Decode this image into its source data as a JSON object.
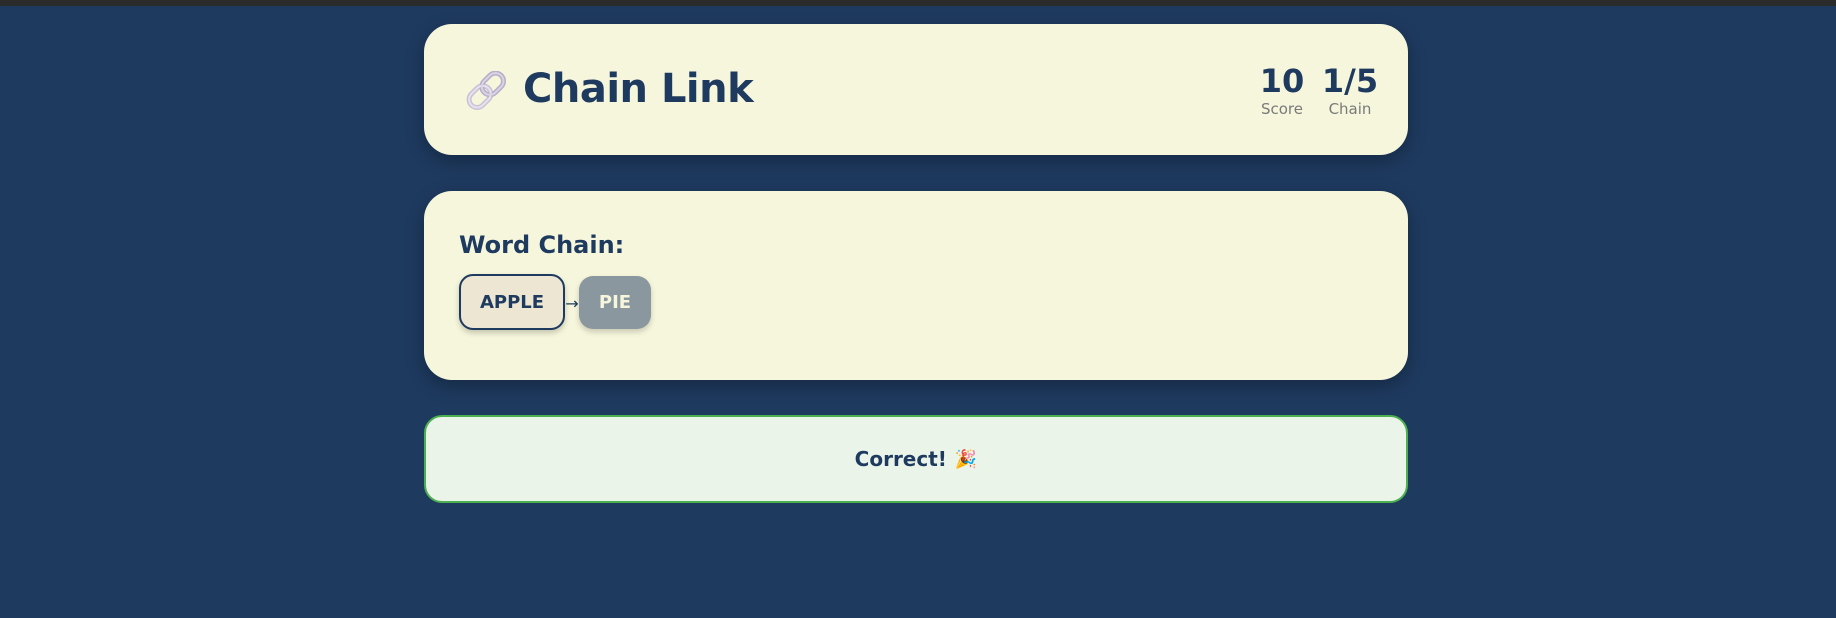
{
  "header": {
    "logo_icon": "link-icon",
    "title": "Chain Link",
    "stats": {
      "score_value": "10",
      "score_label": "Score",
      "chain_value": "1/5",
      "chain_label": "Chain"
    }
  },
  "chain": {
    "heading": "Word Chain:",
    "words": [
      "APPLE",
      "PIE"
    ],
    "arrow": "→"
  },
  "feedback": {
    "text": "Correct!",
    "emoji": "🎉",
    "emoji_icon": "party-popper-icon"
  },
  "colors": {
    "background": "#1e3a5f",
    "card": "#f6f6dc",
    "text": "#1e3a5f",
    "next_tile": "#8a979f",
    "success_border": "#4caf50",
    "success_bg": "#eaf4e8"
  }
}
